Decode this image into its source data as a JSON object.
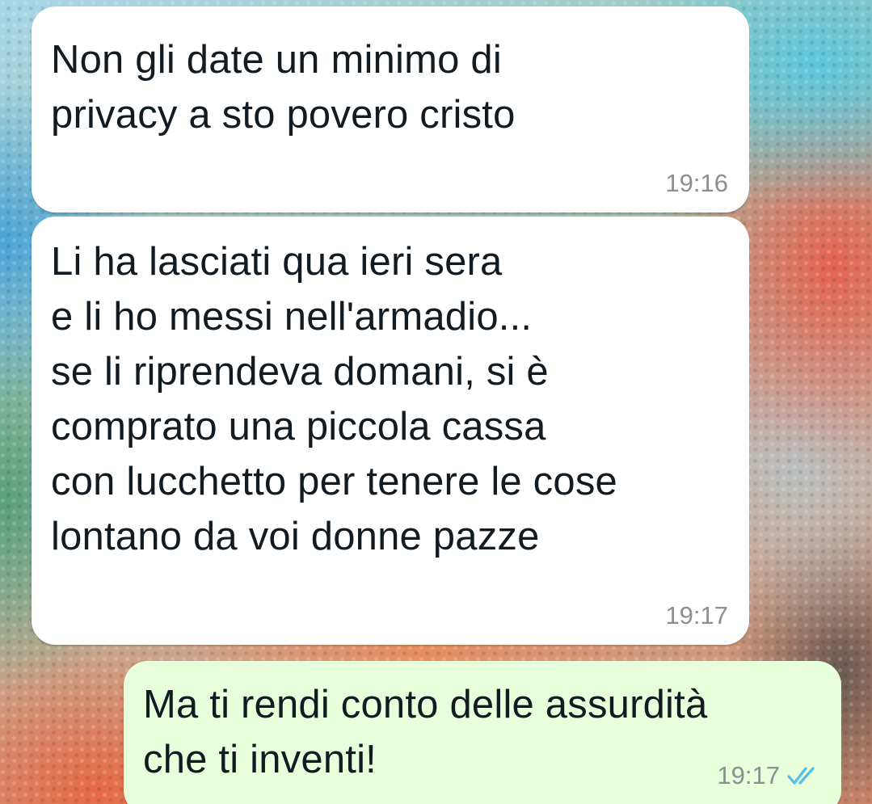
{
  "messages": [
    {
      "direction": "incoming",
      "text": "Non gli date un minimo di\nprivacy a sto povero cristo",
      "time": "19:16"
    },
    {
      "direction": "incoming",
      "text": "Li ha lasciati qua ieri sera\ne li ho messi nell'armadio...\nse li riprendeva domani, si è\ncomprato una piccola cassa\ncon lucchetto per tenere le cose\nlontano da voi donne pazze",
      "time": "19:17"
    },
    {
      "direction": "outgoing",
      "text": "Ma ti rendi conto delle assurdità\nche ti inventi!",
      "time": "19:17",
      "status_icon": "double-check-icon"
    }
  ],
  "colors": {
    "incoming_bubble": "#ffffff",
    "outgoing_bubble": "#e7ffdb",
    "timestamp": "#8a8f93",
    "read_ticks": "#53bdeb"
  }
}
